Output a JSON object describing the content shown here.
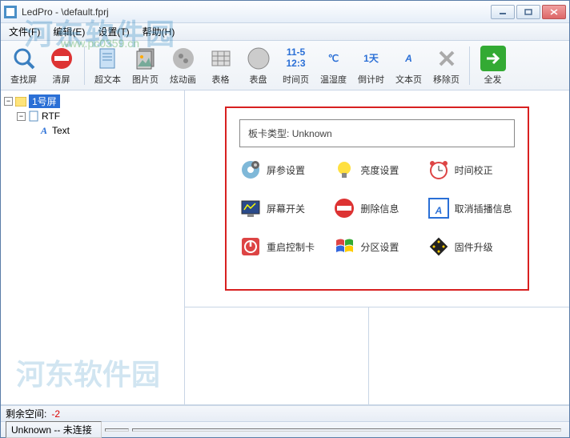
{
  "window": {
    "title": "LedPro - \\default.fprj"
  },
  "menu": {
    "file": "文件(F)",
    "edit": "编辑(E)",
    "settings": "设置(T)",
    "help": "帮助(H)"
  },
  "toolbar": {
    "search_screen": "查找屏",
    "clear_screen": "清屏",
    "hypertext": "超文本",
    "image_page": "图片页",
    "animation": "炫动画",
    "table": "表格",
    "dial": "表盘",
    "time_page": "时间页",
    "time_icon_top": "11-5",
    "time_icon_bottom": "12:3",
    "temp_humidity": "温湿度",
    "temp_icon": "℃",
    "countdown": "倒计时",
    "countdown_icon": "1天",
    "text_page": "文本页",
    "text_icon": "A",
    "remove_page": "移除页",
    "send_all": "全发"
  },
  "tree": {
    "root": "1号屏",
    "rtf": "RTF",
    "text": "Text"
  },
  "panel": {
    "card_type_label": "板卡类型:",
    "card_type_value": "Unknown",
    "screen_params": "屏参设置",
    "brightness": "亮度设置",
    "time_correct": "时间校正",
    "screen_switch": "屏幕开关",
    "delete_info": "删除信息",
    "cancel_insert": "取消插播信息",
    "restart_card": "重启控制卡",
    "partition": "分区设置",
    "firmware": "固件升级"
  },
  "status": {
    "remain_label": "剩余空间:",
    "remain_value": "-2",
    "conn": "Unknown -- 未连接"
  },
  "watermark": {
    "text1": "河东软件园",
    "text2": "www.pc0359.cn",
    "text3": "河东软件园"
  }
}
